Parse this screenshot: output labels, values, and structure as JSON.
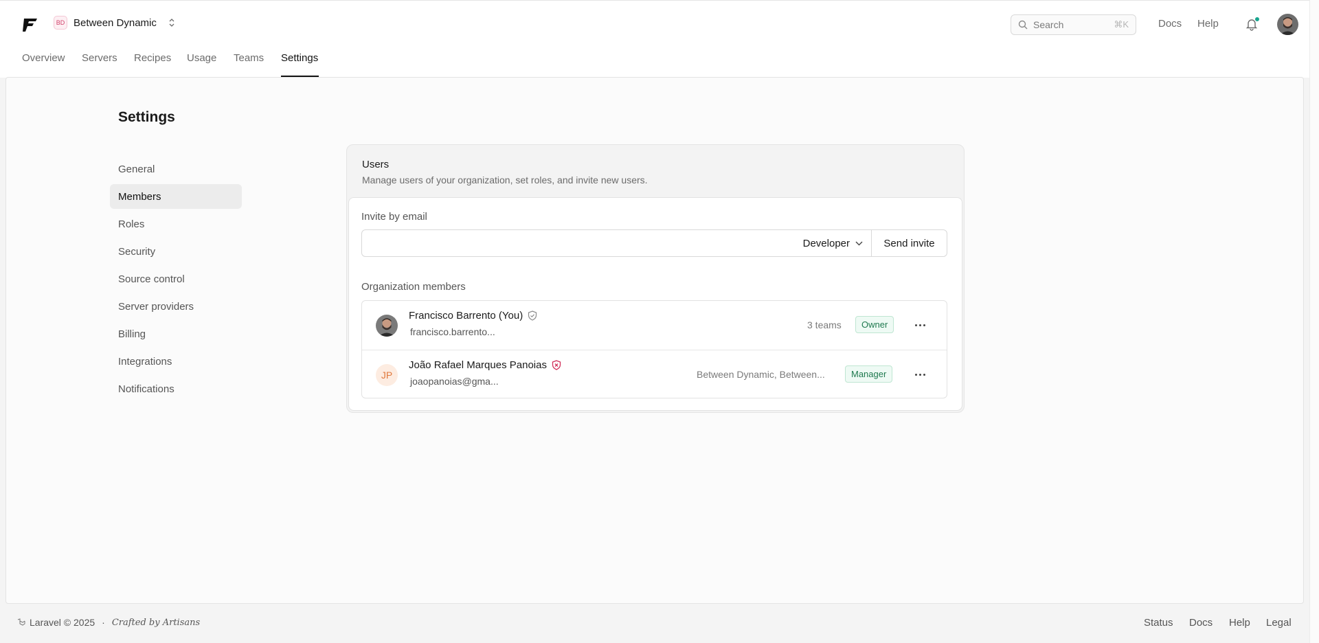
{
  "header": {
    "org_initials": "BD",
    "org_name": "Between Dynamic",
    "search_placeholder": "Search",
    "search_shortcut": "⌘K",
    "docs": "Docs",
    "help": "Help",
    "notification_dot_color": "#18a58f"
  },
  "nav": {
    "tabs": [
      "Overview",
      "Servers",
      "Recipes",
      "Usage",
      "Teams",
      "Settings"
    ],
    "active": "Settings"
  },
  "settings": {
    "title": "Settings",
    "menu": [
      "General",
      "Members",
      "Roles",
      "Security",
      "Source control",
      "Server providers",
      "Billing",
      "Integrations",
      "Notifications"
    ],
    "active": "Members"
  },
  "users": {
    "title": "Users",
    "description": "Manage users of your organization, set roles, and invite new users.",
    "invite_label": "Invite by email",
    "invite_value": "",
    "role_selected": "Developer",
    "send_invite": "Send invite",
    "members_label": "Organization members",
    "members": [
      {
        "name": "Francisco Barrento (You)",
        "email": "francisco.barrento...",
        "teams": "3 teams",
        "role": "Owner",
        "shield_icon": "shield-check-icon",
        "shield_color": "#8a8a8a"
      },
      {
        "initials": "JP",
        "name": "João Rafael Marques Panoias",
        "email": "joaopanoias@gma...",
        "teams": "Between Dynamic, Between...",
        "role": "Manager",
        "shield_icon": "shield-x-icon",
        "shield_color": "#d1315b"
      }
    ]
  },
  "footer": {
    "brand": "Laravel © 2025",
    "separator": "·",
    "crafted": "Crafted by Artisans",
    "links": [
      "Status",
      "Docs",
      "Help",
      "Legal"
    ]
  }
}
